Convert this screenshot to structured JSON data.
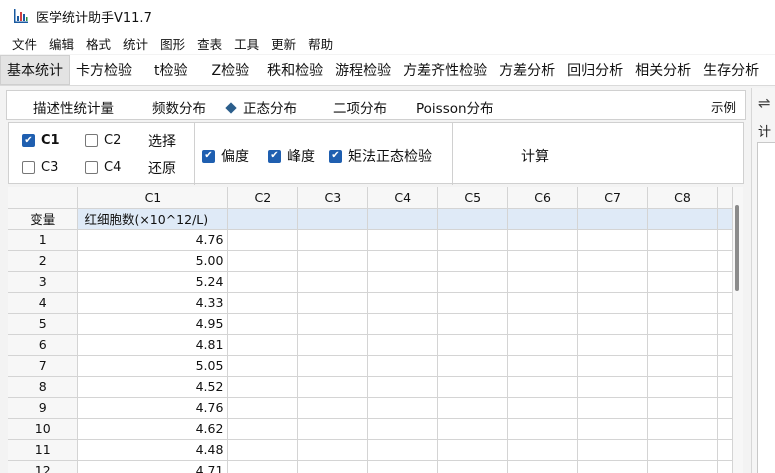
{
  "window": {
    "title": "医学统计助手V11.7",
    "icon": "bar-chart-icon"
  },
  "menu": [
    "文件",
    "编辑",
    "格式",
    "统计",
    "图形",
    "查表",
    "工具",
    "更新",
    "帮助"
  ],
  "main_tabs": [
    "基本统计",
    "卡方检验",
    "t检验",
    "Z检验",
    "秩和检验",
    "游程检验",
    "方差齐性检验",
    "方差分析",
    "回归分析",
    "相关分析",
    "生存分析"
  ],
  "sub_tabs": {
    "descriptive": "描述性统计量",
    "frequency": "频数分布",
    "normal": "正态分布",
    "binomial": "二项分布",
    "poisson": "Poisson分布",
    "example": "示例"
  },
  "columns_select": [
    {
      "label": "C1",
      "checked": true
    },
    {
      "label": "C2",
      "checked": false
    },
    {
      "label": "C3",
      "checked": false
    },
    {
      "label": "C4",
      "checked": false
    }
  ],
  "buttons": {
    "select": "选择",
    "reset": "还原",
    "calculate": "计算"
  },
  "options": [
    {
      "label": "偏度",
      "checked": true
    },
    {
      "label": "峰度",
      "checked": true
    },
    {
      "label": "矩法正态检验",
      "checked": true
    }
  ],
  "right_panel": {
    "swap_icon": "⇌",
    "label": "计"
  },
  "grid": {
    "headers": [
      "C1",
      "C2",
      "C3",
      "C4",
      "C5",
      "C6",
      "C7",
      "C8"
    ],
    "variable_label": "变量",
    "variable_name": "红细胞数(×10^12/L)",
    "rows": [
      {
        "n": "1",
        "v": "4.76"
      },
      {
        "n": "2",
        "v": "5.00"
      },
      {
        "n": "3",
        "v": "5.24"
      },
      {
        "n": "4",
        "v": "4.33"
      },
      {
        "n": "5",
        "v": "4.95"
      },
      {
        "n": "6",
        "v": "4.81"
      },
      {
        "n": "7",
        "v": "5.05"
      },
      {
        "n": "8",
        "v": "4.52"
      },
      {
        "n": "9",
        "v": "4.76"
      },
      {
        "n": "10",
        "v": "4.62"
      },
      {
        "n": "11",
        "v": "4.48"
      },
      {
        "n": "12",
        "v": "4.71"
      }
    ]
  }
}
